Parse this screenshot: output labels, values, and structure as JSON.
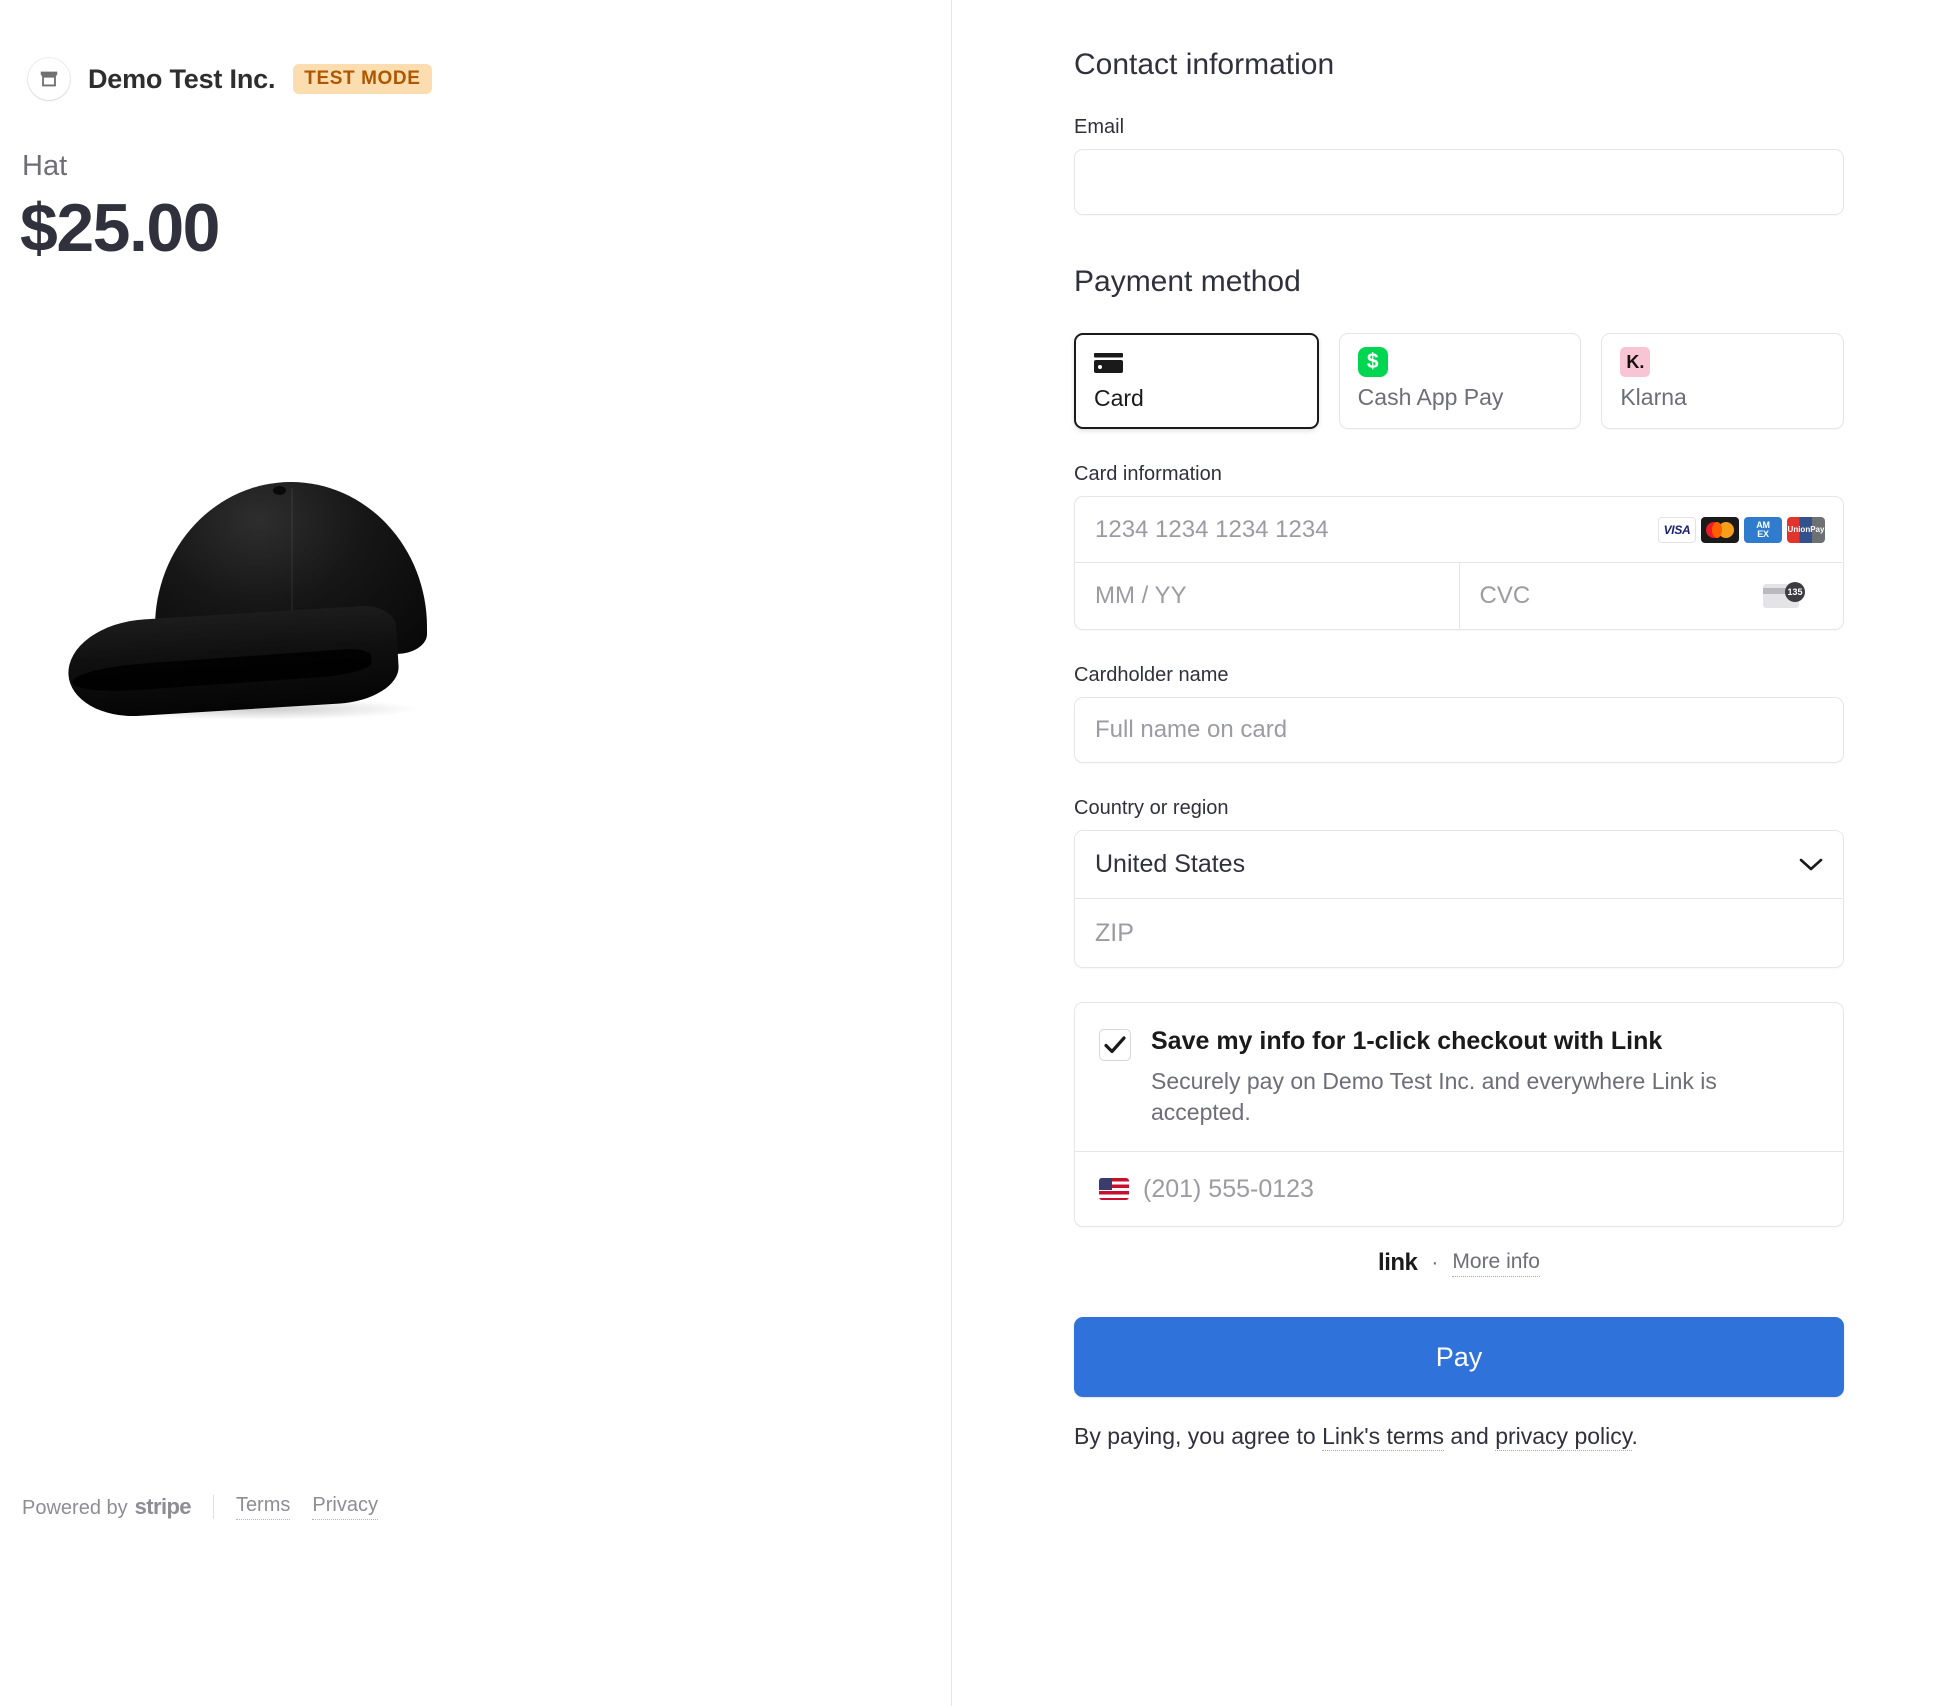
{
  "merchant": {
    "name": "Demo Test Inc.",
    "badge": "TEST MODE",
    "icon": "store-icon"
  },
  "product": {
    "name": "Hat",
    "price": "$25.00",
    "image_alt": "black-baseball-cap"
  },
  "left_footer": {
    "powered_by": "Powered by",
    "brand": "stripe",
    "terms": "Terms",
    "privacy": "Privacy"
  },
  "contact": {
    "title": "Contact information",
    "email_label": "Email",
    "email_value": "",
    "email_placeholder": ""
  },
  "payment": {
    "title": "Payment method",
    "tabs": [
      {
        "label": "Card",
        "icon": "credit-card-icon",
        "selected": true
      },
      {
        "label": "Cash App Pay",
        "icon": "cash-app-icon",
        "selected": false
      },
      {
        "label": "Klarna",
        "icon": "klarna-icon",
        "selected": false
      }
    ]
  },
  "card": {
    "label": "Card information",
    "number_placeholder": "1234 1234 1234 1234",
    "number_value": "",
    "expiry_placeholder": "MM / YY",
    "expiry_value": "",
    "cvc_placeholder": "CVC",
    "cvc_value": "",
    "cvc_hint_digits": "135",
    "brands": [
      "VISA",
      "Mastercard",
      "AMEX",
      "UnionPay"
    ],
    "brand_labels": {
      "visa": "VISA",
      "amex_top": "AM",
      "amex_bottom": "EX",
      "unionpay": "UnionPay"
    }
  },
  "cardholder": {
    "label": "Cardholder name",
    "placeholder": "Full name on card",
    "value": ""
  },
  "country": {
    "label": "Country or region",
    "selected": "United States",
    "chevron": "chevron-down-icon",
    "zip_placeholder": "ZIP",
    "zip_value": ""
  },
  "link": {
    "checked": true,
    "headline": "Save my info for 1-click checkout with Link",
    "subtext": "Securely pay on Demo Test Inc. and everywhere Link is accepted.",
    "phone_placeholder": "(201) 555-0123",
    "phone_value": "",
    "flag": "us-flag-icon",
    "logo": "link",
    "separator": "·",
    "more_info": "More info"
  },
  "pay": {
    "button_label": "Pay",
    "terms_prefix": "By paying, you agree to ",
    "terms_link": "Link's terms",
    "terms_middle": " and ",
    "privacy_link": "privacy policy",
    "terms_suffix": "."
  },
  "colors": {
    "accent_blue": "#2f72d9",
    "badge_bg": "#fcddb0",
    "badge_text": "#ad5700",
    "cashapp_green": "#00d64f",
    "klarna_pink": "#f7c5d4",
    "text_primary": "#30313d",
    "text_muted": "#6d6e78",
    "border": "#e6e6e9"
  }
}
